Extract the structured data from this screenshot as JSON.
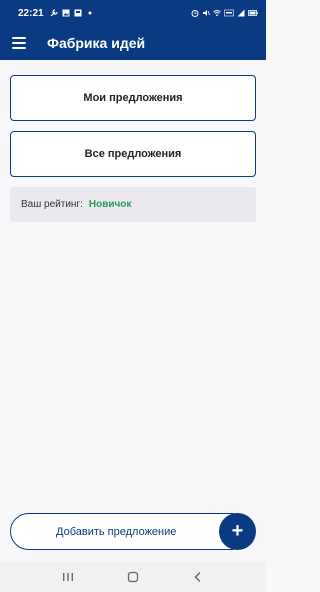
{
  "status_bar": {
    "time": "22:21",
    "icons": [
      "wrench-icon",
      "image-icon",
      "notification-icon",
      "dot-icon",
      "alarm-icon",
      "mute-icon",
      "wifi-icon",
      "volte-icon",
      "signal-icon",
      "battery-icon"
    ]
  },
  "app_bar": {
    "menu_icon": "hamburger-menu-icon",
    "title": "Фабрика идей"
  },
  "main": {
    "my_proposals_label": "Мои предложения",
    "all_proposals_label": "Все предложения",
    "rating_label": "Ваш рейтинг:",
    "rating_value": "Новичок"
  },
  "bottom": {
    "add_proposal_label": "Добавить предложение",
    "fab_icon": "plus-icon",
    "fab_symbol": "+"
  },
  "nav_bar": {
    "items": [
      "recent-apps-icon",
      "home-icon",
      "back-icon"
    ]
  },
  "colors": {
    "primary": "#0a3b82",
    "rating_accent": "#2e9a5a",
    "background": "#f8f8fa",
    "rating_bg": "#ebe8ee"
  }
}
